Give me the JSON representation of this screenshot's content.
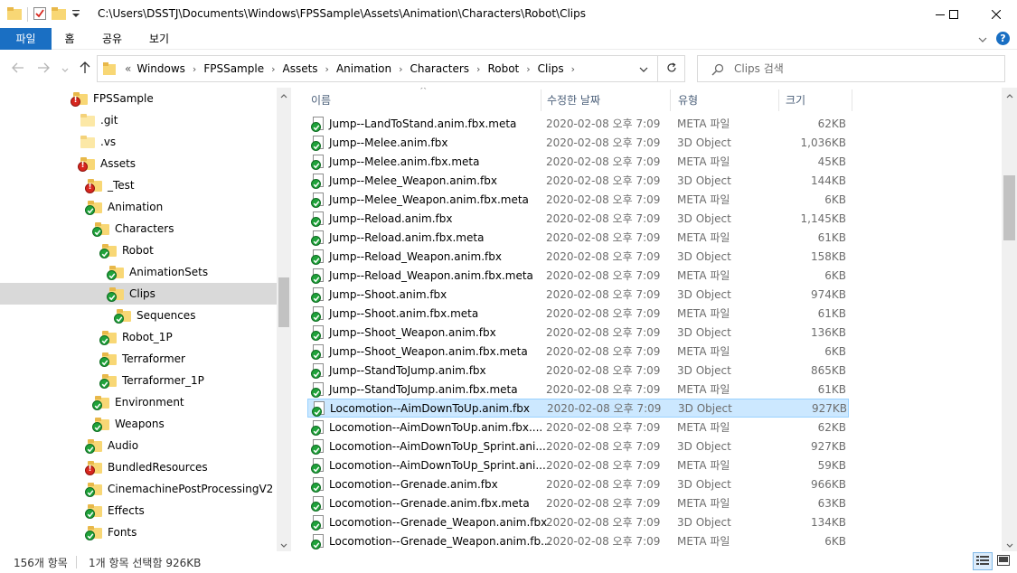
{
  "window": {
    "title_path": "C:\\Users\\DSSTJ\\Documents\\Windows\\FPSSample\\Assets\\Animation\\Characters\\Robot\\Clips",
    "minimize_glyph": "minimize-icon",
    "maximize_glyph": "maximize-icon",
    "close_glyph": "close-icon"
  },
  "ribbon": {
    "tabs": [
      "파일",
      "홈",
      "공유",
      "보기"
    ],
    "file_color": "#1a6fc3"
  },
  "address": {
    "overflow": "«",
    "crumbs": [
      "Windows",
      "FPSSample",
      "Assets",
      "Animation",
      "Characters",
      "Robot",
      "Clips"
    ],
    "search_placeholder": "Clips 검색"
  },
  "tree": [
    {
      "label": "FPSSample",
      "indent": 0,
      "status": "red",
      "plain": false,
      "selected": false
    },
    {
      "label": ".git",
      "indent": 1,
      "status": "none",
      "plain": true,
      "selected": false
    },
    {
      "label": ".vs",
      "indent": 1,
      "status": "none",
      "plain": true,
      "selected": false
    },
    {
      "label": "Assets",
      "indent": 1,
      "status": "red",
      "plain": false,
      "selected": false
    },
    {
      "label": "_Test",
      "indent": 2,
      "status": "red",
      "plain": false,
      "selected": false
    },
    {
      "label": "Animation",
      "indent": 2,
      "status": "green",
      "plain": false,
      "selected": false
    },
    {
      "label": "Characters",
      "indent": 3,
      "status": "green",
      "plain": false,
      "selected": false
    },
    {
      "label": "Robot",
      "indent": 4,
      "status": "green",
      "plain": false,
      "selected": false
    },
    {
      "label": "AnimationSets",
      "indent": 5,
      "status": "green",
      "plain": false,
      "selected": false
    },
    {
      "label": "Clips",
      "indent": 5,
      "status": "green",
      "plain": false,
      "selected": true
    },
    {
      "label": "Sequences",
      "indent": 6,
      "status": "green",
      "plain": false,
      "selected": false
    },
    {
      "label": "Robot_1P",
      "indent": 4,
      "status": "green",
      "plain": false,
      "selected": false
    },
    {
      "label": "Terraformer",
      "indent": 4,
      "status": "green",
      "plain": false,
      "selected": false
    },
    {
      "label": "Terraformer_1P",
      "indent": 4,
      "status": "green",
      "plain": false,
      "selected": false
    },
    {
      "label": "Environment",
      "indent": 3,
      "status": "green",
      "plain": false,
      "selected": false
    },
    {
      "label": "Weapons",
      "indent": 3,
      "status": "green",
      "plain": false,
      "selected": false
    },
    {
      "label": "Audio",
      "indent": 2,
      "status": "green",
      "plain": false,
      "selected": false
    },
    {
      "label": "BundledResources",
      "indent": 2,
      "status": "red",
      "plain": false,
      "selected": false
    },
    {
      "label": "CinemachinePostProcessingV2",
      "indent": 2,
      "status": "green",
      "plain": false,
      "selected": false
    },
    {
      "label": "Effects",
      "indent": 2,
      "status": "green",
      "plain": false,
      "selected": false
    },
    {
      "label": "Fonts",
      "indent": 2,
      "status": "green",
      "plain": false,
      "selected": false
    }
  ],
  "columns": {
    "name": "이름",
    "date": "수정한 날짜",
    "type": "유형",
    "size": "크기"
  },
  "files": [
    {
      "name": "Jump--LandToStand.anim.fbx.meta",
      "date": "2020-02-08 오후 7:09",
      "type": "META 파일",
      "size": "62KB",
      "selected": false
    },
    {
      "name": "Jump--Melee.anim.fbx",
      "date": "2020-02-08 오후 7:09",
      "type": "3D Object",
      "size": "1,036KB",
      "selected": false
    },
    {
      "name": "Jump--Melee.anim.fbx.meta",
      "date": "2020-02-08 오후 7:09",
      "type": "META 파일",
      "size": "45KB",
      "selected": false
    },
    {
      "name": "Jump--Melee_Weapon.anim.fbx",
      "date": "2020-02-08 오후 7:09",
      "type": "3D Object",
      "size": "144KB",
      "selected": false
    },
    {
      "name": "Jump--Melee_Weapon.anim.fbx.meta",
      "date": "2020-02-08 오후 7:09",
      "type": "META 파일",
      "size": "6KB",
      "selected": false
    },
    {
      "name": "Jump--Reload.anim.fbx",
      "date": "2020-02-08 오후 7:09",
      "type": "3D Object",
      "size": "1,145KB",
      "selected": false
    },
    {
      "name": "Jump--Reload.anim.fbx.meta",
      "date": "2020-02-08 오후 7:09",
      "type": "META 파일",
      "size": "61KB",
      "selected": false
    },
    {
      "name": "Jump--Reload_Weapon.anim.fbx",
      "date": "2020-02-08 오후 7:09",
      "type": "3D Object",
      "size": "158KB",
      "selected": false
    },
    {
      "name": "Jump--Reload_Weapon.anim.fbx.meta",
      "date": "2020-02-08 오후 7:09",
      "type": "META 파일",
      "size": "6KB",
      "selected": false
    },
    {
      "name": "Jump--Shoot.anim.fbx",
      "date": "2020-02-08 오후 7:09",
      "type": "3D Object",
      "size": "974KB",
      "selected": false
    },
    {
      "name": "Jump--Shoot.anim.fbx.meta",
      "date": "2020-02-08 오후 7:09",
      "type": "META 파일",
      "size": "61KB",
      "selected": false
    },
    {
      "name": "Jump--Shoot_Weapon.anim.fbx",
      "date": "2020-02-08 오후 7:09",
      "type": "3D Object",
      "size": "136KB",
      "selected": false
    },
    {
      "name": "Jump--Shoot_Weapon.anim.fbx.meta",
      "date": "2020-02-08 오후 7:09",
      "type": "META 파일",
      "size": "6KB",
      "selected": false
    },
    {
      "name": "Jump--StandToJump.anim.fbx",
      "date": "2020-02-08 오후 7:09",
      "type": "3D Object",
      "size": "865KB",
      "selected": false
    },
    {
      "name": "Jump--StandToJump.anim.fbx.meta",
      "date": "2020-02-08 오후 7:09",
      "type": "META 파일",
      "size": "61KB",
      "selected": false
    },
    {
      "name": "Locomotion--AimDownToUp.anim.fbx",
      "date": "2020-02-08 오후 7:09",
      "type": "3D Object",
      "size": "927KB",
      "selected": true
    },
    {
      "name": "Locomotion--AimDownToUp.anim.fbx....",
      "date": "2020-02-08 오후 7:09",
      "type": "META 파일",
      "size": "62KB",
      "selected": false
    },
    {
      "name": "Locomotion--AimDownToUp_Sprint.ani...",
      "date": "2020-02-08 오후 7:09",
      "type": "3D Object",
      "size": "927KB",
      "selected": false
    },
    {
      "name": "Locomotion--AimDownToUp_Sprint.ani...",
      "date": "2020-02-08 오후 7:09",
      "type": "META 파일",
      "size": "59KB",
      "selected": false
    },
    {
      "name": "Locomotion--Grenade.anim.fbx",
      "date": "2020-02-08 오후 7:09",
      "type": "3D Object",
      "size": "966KB",
      "selected": false
    },
    {
      "name": "Locomotion--Grenade.anim.fbx.meta",
      "date": "2020-02-08 오후 7:09",
      "type": "META 파일",
      "size": "63KB",
      "selected": false
    },
    {
      "name": "Locomotion--Grenade_Weapon.anim.fbx",
      "date": "2020-02-08 오후 7:09",
      "type": "3D Object",
      "size": "134KB",
      "selected": false
    },
    {
      "name": "Locomotion--Grenade_Weapon.anim.fb...",
      "date": "2020-02-08 오후 7:09",
      "type": "META 파일",
      "size": "6KB",
      "selected": false
    }
  ],
  "status": {
    "item_count": "156개 항목",
    "selection": "1개 항목 선택함 926KB"
  },
  "colors": {
    "selection_bg": "#cce8ff",
    "selection_border": "#99d1ff",
    "tree_selected": "#d9d9d9",
    "status_green": "#1fa23a",
    "status_red": "#d7261e"
  }
}
